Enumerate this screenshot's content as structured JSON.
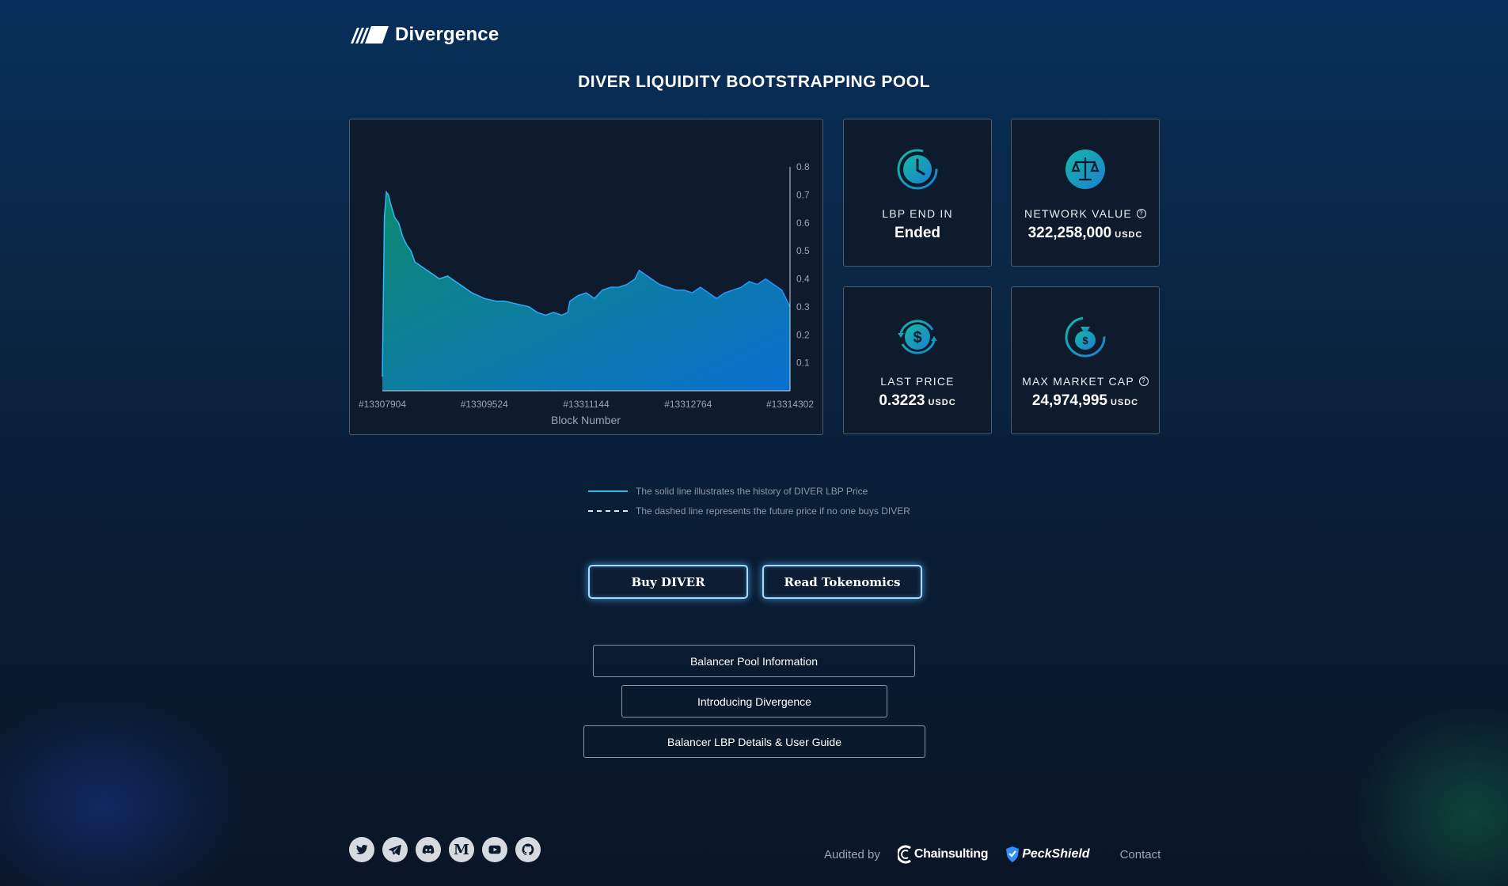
{
  "brand": {
    "name": "Divergence"
  },
  "page": {
    "title": "DIVER LIQUIDITY BOOTSTRAPPING POOL"
  },
  "chart_data": {
    "type": "area",
    "xlabel": "Block Number",
    "x_tick_labels": [
      "#13307904",
      "#13309524",
      "#13311144",
      "#13312764",
      "#13314302"
    ],
    "y_tick_labels": [
      "0.1",
      "0.2",
      "0.3",
      "0.4",
      "0.5",
      "0.6",
      "0.7",
      "0.8"
    ],
    "ylim": [
      0,
      0.8
    ],
    "x_fraction": [
      0.0,
      0.005,
      0.01,
      0.015,
      0.02,
      0.03,
      0.04,
      0.05,
      0.06,
      0.07,
      0.08,
      0.09,
      0.1,
      0.12,
      0.14,
      0.16,
      0.18,
      0.2,
      0.22,
      0.25,
      0.28,
      0.3,
      0.33,
      0.36,
      0.38,
      0.4,
      0.42,
      0.44,
      0.455,
      0.46,
      0.48,
      0.5,
      0.52,
      0.54,
      0.56,
      0.58,
      0.6,
      0.62,
      0.63,
      0.64,
      0.66,
      0.68,
      0.7,
      0.72,
      0.74,
      0.76,
      0.78,
      0.8,
      0.82,
      0.84,
      0.86,
      0.88,
      0.9,
      0.92,
      0.94,
      0.96,
      0.98,
      1.0
    ],
    "values": [
      0.05,
      0.62,
      0.71,
      0.7,
      0.67,
      0.62,
      0.6,
      0.55,
      0.52,
      0.5,
      0.46,
      0.45,
      0.44,
      0.42,
      0.4,
      0.41,
      0.39,
      0.37,
      0.35,
      0.33,
      0.32,
      0.32,
      0.31,
      0.3,
      0.28,
      0.27,
      0.28,
      0.27,
      0.28,
      0.32,
      0.34,
      0.35,
      0.33,
      0.36,
      0.37,
      0.37,
      0.38,
      0.4,
      0.43,
      0.42,
      0.4,
      0.38,
      0.37,
      0.36,
      0.36,
      0.35,
      0.37,
      0.35,
      0.33,
      0.35,
      0.36,
      0.37,
      0.39,
      0.38,
      0.4,
      0.38,
      0.36,
      0.3
    ],
    "grid": false
  },
  "stats": {
    "lbp_end": {
      "label": "LBP END IN",
      "value": "Ended"
    },
    "network_value": {
      "label": "NETWORK VALUE",
      "value": "322,258,000",
      "unit": "USDC"
    },
    "last_price": {
      "label": "LAST PRICE",
      "value": "0.3223",
      "unit": "USDC"
    },
    "max_market_cap": {
      "label": "MAX MARKET CAP",
      "value": "24,974,995",
      "unit": "USDC"
    }
  },
  "legend": {
    "solid": "The solid line illustrates the history of DIVER LBP Price",
    "dashed": "The dashed line represents the future price if no one buys DIVER"
  },
  "actions": {
    "buy": "Buy DIVER",
    "tokenomics": "Read Tokenomics"
  },
  "links": {
    "pool_info": "Balancer Pool Information",
    "introducing": "Introducing Divergence",
    "details": "Balancer LBP Details & User Guide"
  },
  "footer": {
    "audited_by": "Audited by",
    "auditor1": "Chainsulting",
    "auditor2": "PeckShield",
    "contact": "Contact",
    "social_icons": [
      "twitter-icon",
      "telegram-icon",
      "discord-icon",
      "medium-icon",
      "youtube-icon",
      "github-icon"
    ],
    "medium_glyph": "M"
  },
  "colors": {
    "accent": "#5ab4ff",
    "area_top": "#0d8a70",
    "area_bottom": "#0a6fd0"
  }
}
